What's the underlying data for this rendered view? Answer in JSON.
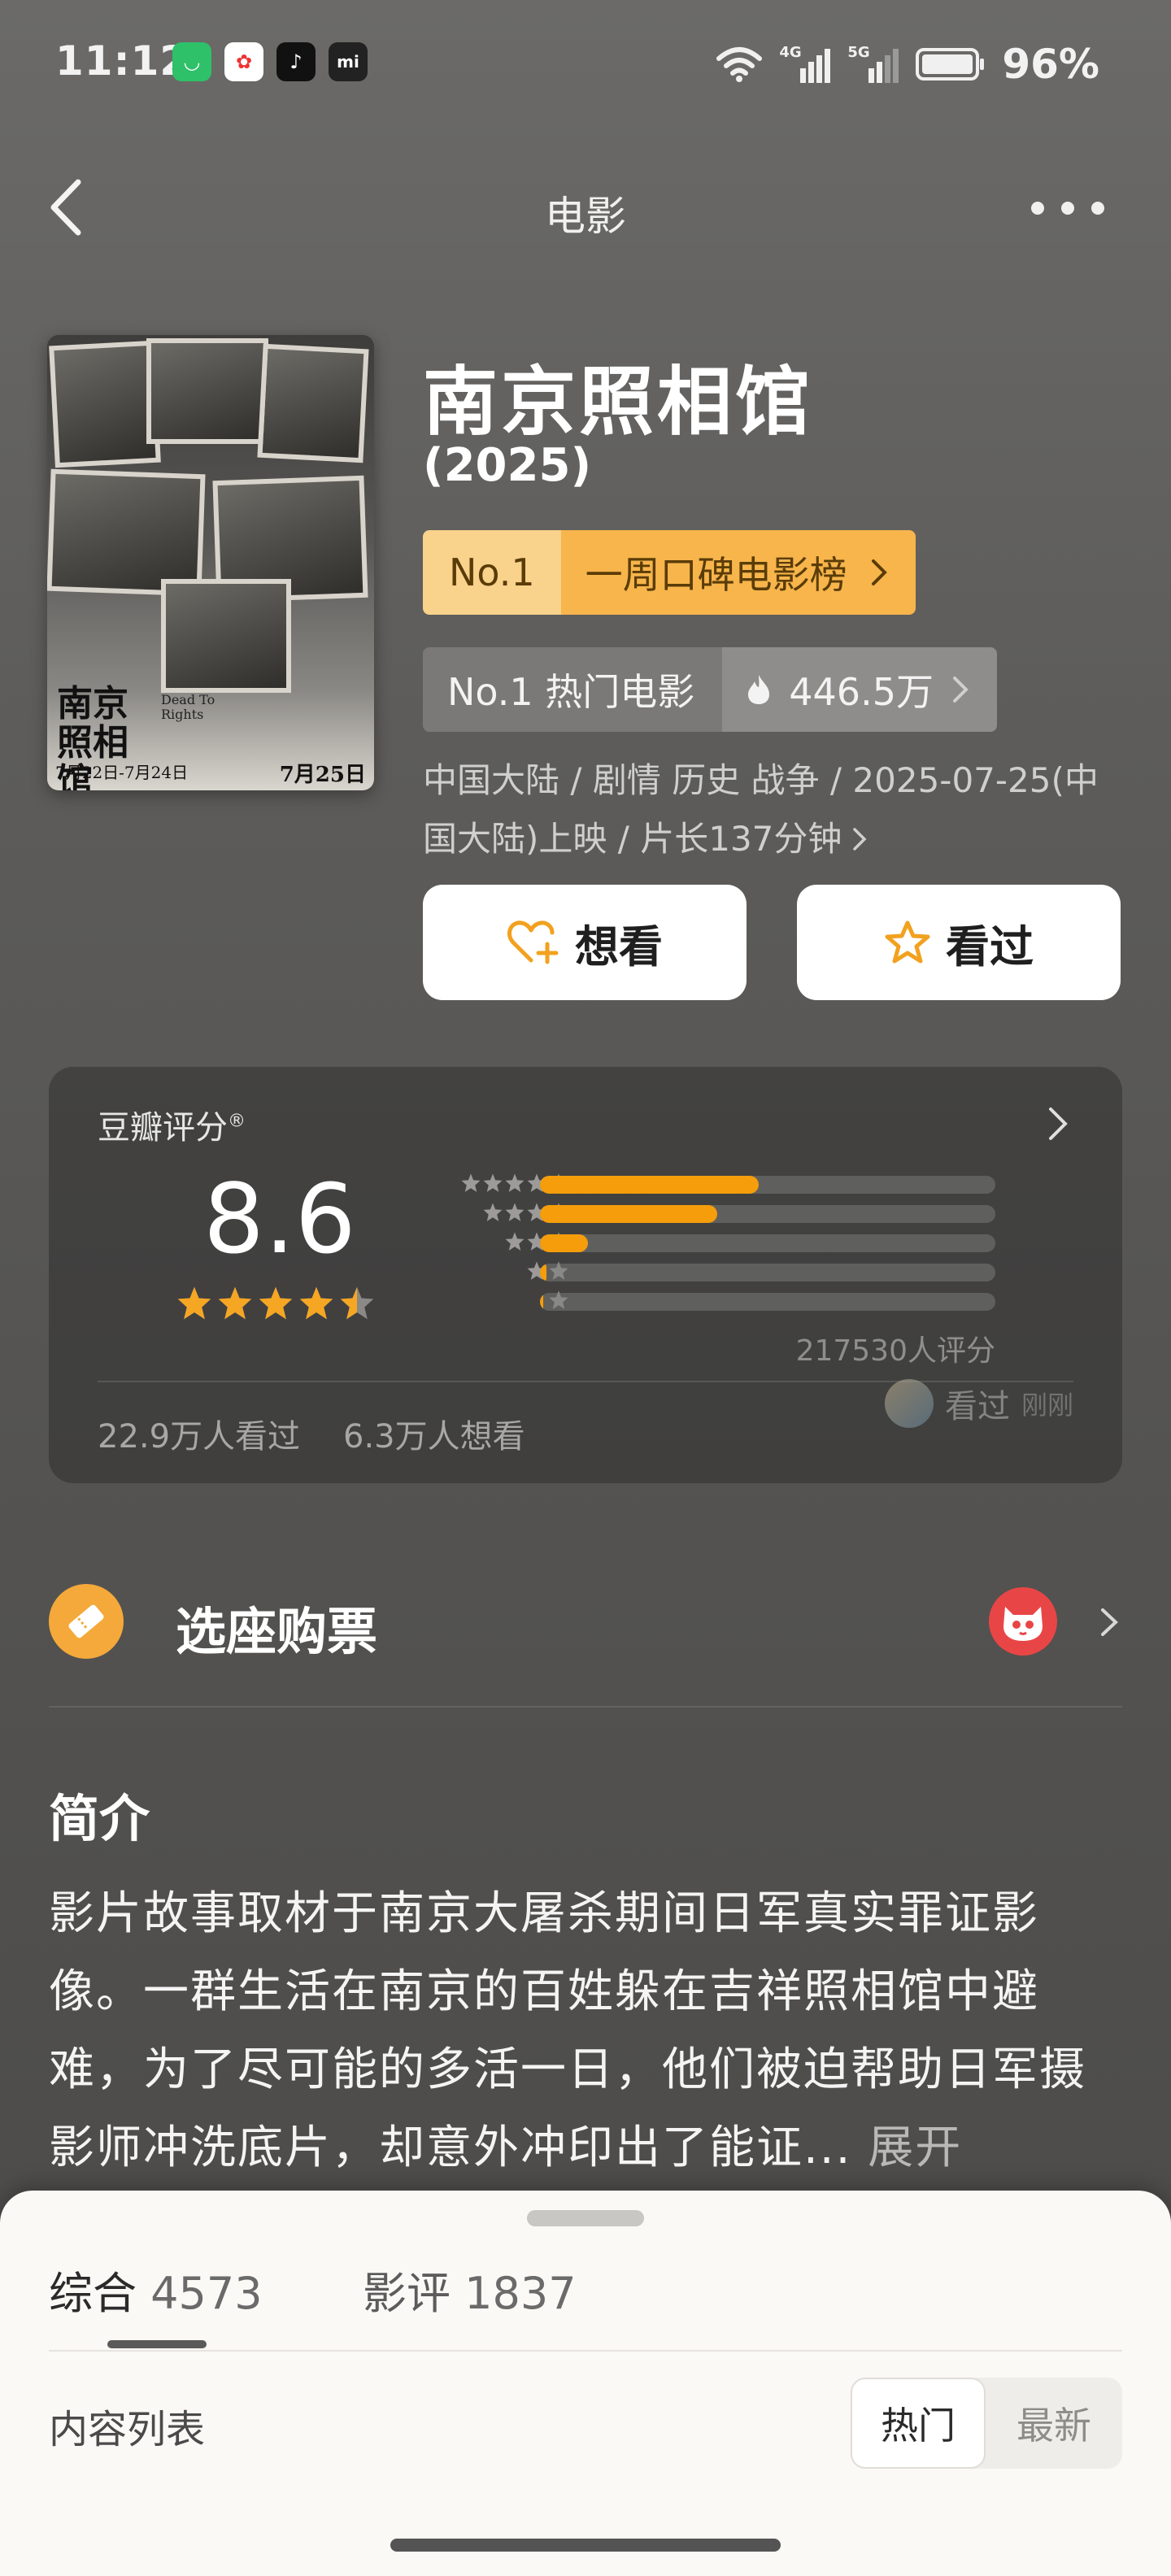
{
  "status_bar": {
    "time": "11:12",
    "network_1": "4G",
    "network_2": "5G",
    "battery": "96%"
  },
  "nav": {
    "title": "电影"
  },
  "poster": {
    "title_cn": "南京照相馆",
    "title_en": "Dead To Rights",
    "dates": "7月22日-7月24日",
    "release": "7月25日"
  },
  "movie": {
    "title": "南京照相馆",
    "year": "(2025)",
    "rank_no": "No.1",
    "rank_list": "一周口碑电影榜",
    "hot_no": "No.1 热门电影",
    "hot_count": "446.5万",
    "meta_line1": "中国大陆 / 剧情 历史 战争 / 2025-07-25(中",
    "meta_line2": "国大陆)上映 / 片长137分钟"
  },
  "actions": {
    "want": "想看",
    "watched": "看过"
  },
  "rating": {
    "label": "豆瓣评分",
    "trademark": "®",
    "score": "8.6",
    "stars": 4.5,
    "distribution": [
      {
        "stars": 5,
        "fraction": 0.48
      },
      {
        "stars": 4,
        "fraction": 0.39
      },
      {
        "stars": 3,
        "fraction": 0.105
      },
      {
        "stars": 2,
        "fraction": 0.015
      },
      {
        "stars": 1,
        "fraction": 0.008
      }
    ],
    "count": "217530人评分",
    "watched_stat": "22.9万人看过",
    "wish_stat": "6.3万人想看",
    "friend_action": "看过",
    "friend_time": "刚刚"
  },
  "ticket": {
    "label": "选座购票"
  },
  "intro": {
    "heading": "简介",
    "text": "影片故事取材于南京大屠杀期间日军真实罪证影像。一群生活在南京的百姓躲在吉祥照相馆中避难，为了尽可能的多活一日，他们被迫帮助日军摄影师冲洗底片，却意外冲印出了能证...",
    "expand": "展开"
  },
  "sheet": {
    "tab_overall": "综合",
    "tab_overall_count": "4573",
    "tab_reviews": "影评",
    "tab_reviews_count": "1837",
    "content_list": "内容列表",
    "sort_hot": "热门",
    "sort_new": "最新"
  },
  "colors": {
    "accent_orange": "#f59d0b",
    "rank_light": "#f9d28b",
    "rank_dark": "#f7b54b",
    "star": "#f5a623"
  }
}
